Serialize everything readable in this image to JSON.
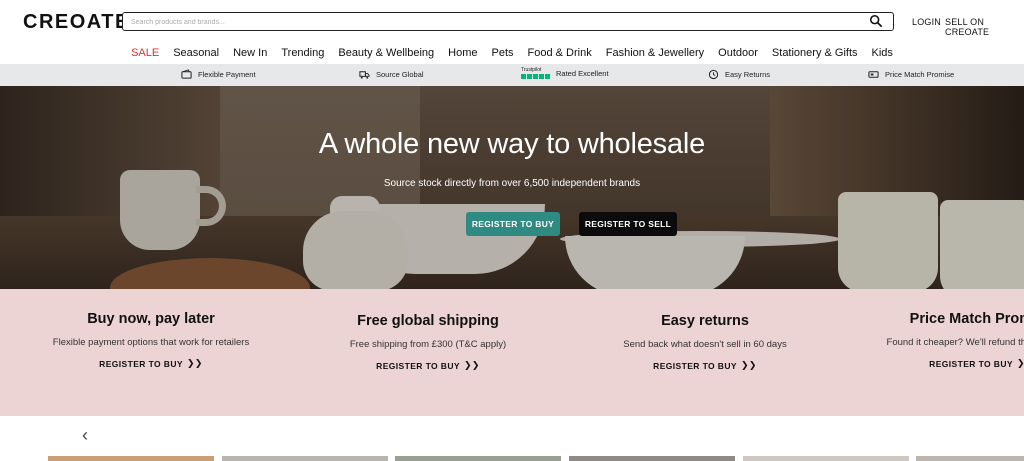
{
  "header": {
    "logo": "CREOATE",
    "search_placeholder": "Search products and brands...",
    "login": "LOGIN",
    "sell": "SELL ON CREOATE"
  },
  "nav": [
    "SALE",
    "Seasonal",
    "New In",
    "Trending",
    "Beauty & Wellbeing",
    "Home",
    "Pets",
    "Food & Drink",
    "Fashion & Jewellery",
    "Outdoor",
    "Stationery & Gifts",
    "Kids"
  ],
  "strip": {
    "flexible_payment": "Flexible Payment",
    "source_global": "Source Global",
    "trustpilot_word": "Trustpilot",
    "rated_excellent": "Rated Excellent",
    "easy_returns": "Easy Returns",
    "price_match": "Price Match Promise"
  },
  "hero": {
    "title": "A whole new way to wholesale",
    "subtitle": "Source stock directly from over 6,500 independent brands",
    "buy_button": "REGISTER TO BUY",
    "sell_button": "REGISTER TO SELL"
  },
  "features": [
    {
      "title": "Buy now, pay later",
      "desc": "Flexible payment options that work for retailers",
      "link": "REGISTER TO BUY"
    },
    {
      "title": "Free global shipping",
      "desc": "Free shipping from £300 (T&C apply)",
      "link": "REGISTER TO BUY"
    },
    {
      "title": "Easy returns",
      "desc": "Send back what doesn't sell in 60 days",
      "link": "REGISTER TO BUY"
    },
    {
      "title": "Price Match Promise",
      "desc": "Found it cheaper? We'll refund the difference",
      "link": "REGISTER TO BUY"
    }
  ],
  "colors": {
    "sale": "#e0302e",
    "buy_button": "#2f8a82",
    "sell_button": "#0b0b0b",
    "features_bg": "#ecd3d4",
    "strip_bg": "#e6e8ea"
  }
}
